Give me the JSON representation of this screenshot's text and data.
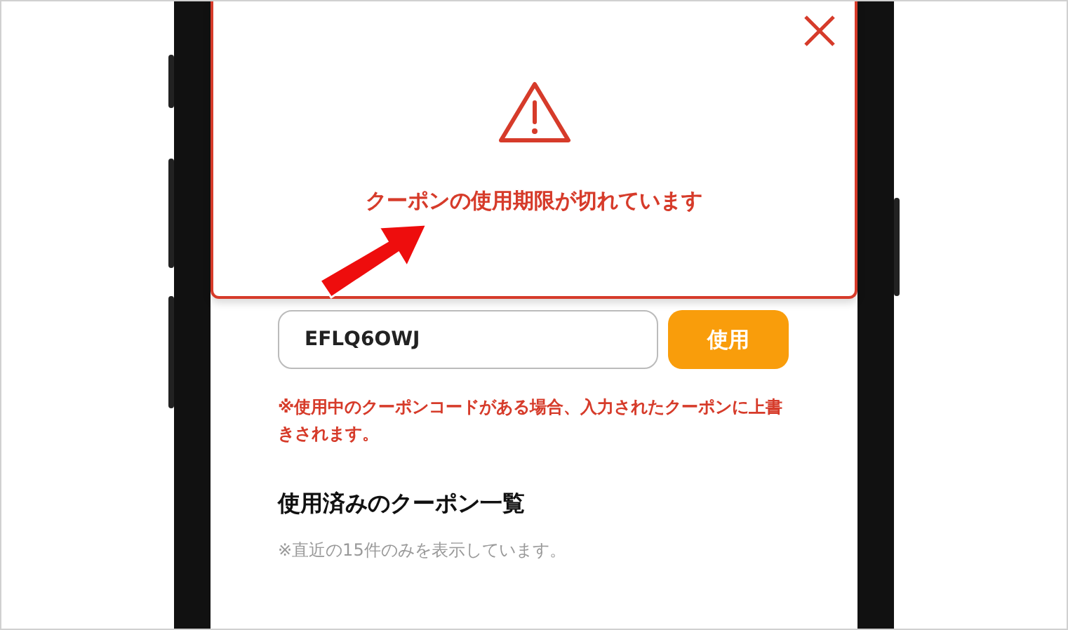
{
  "modal": {
    "message": "クーポンの使用期限が切れています"
  },
  "coupon_form": {
    "code_value": "EFLQ6OWJ",
    "apply_button": "使用",
    "note": "※使用中のクーポンコードがある場合、入力されたクーポンに上書きされます。"
  },
  "used_coupons": {
    "heading": "使用済みのクーポン一覧",
    "note": "※直近の15件のみを表示しています。"
  }
}
